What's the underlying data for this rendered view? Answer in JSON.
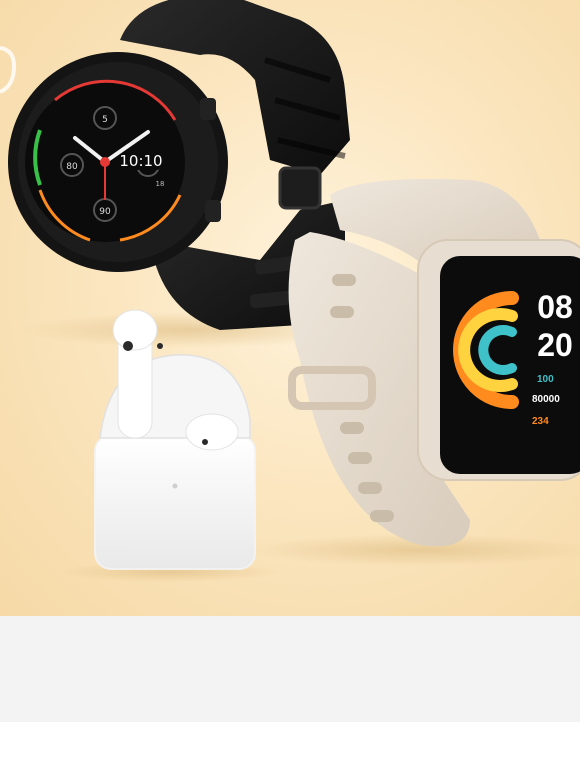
{
  "hero": {
    "round_watch": {
      "time": "10:10",
      "num_top": "5",
      "num_left": "80",
      "num_bottom": "90",
      "num_right": "18"
    },
    "square_watch": {
      "hour": "08",
      "minute": "20",
      "stat_1": "100",
      "stat_2": "80000",
      "stat_3": "234"
    }
  },
  "colors": {
    "background_warm": "#fbe6c0",
    "band_gray": "#f3f3f3",
    "watch_black": "#151515",
    "strap_ivory": "#e6ddd1",
    "accent_orange": "#ff8a1e",
    "accent_red": "#e53935",
    "accent_green": "#39c24a"
  }
}
